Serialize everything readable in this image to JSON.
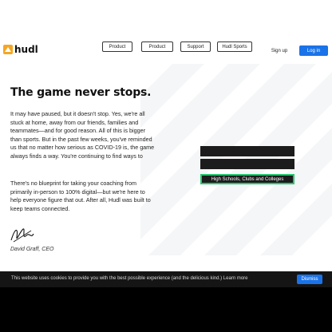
{
  "header": {
    "logo_text": "hudl",
    "nav": [
      "Product",
      "Product",
      "Support",
      "Hudl Sports"
    ],
    "signup_label": "Sign up",
    "login_label": "Log in"
  },
  "hero": {
    "heading": "The game never stops.",
    "paragraph1": "It may have paused, but it doesn't stop. Yes, we're all stuck at home, away from our friends, families and teammates—and for good reason. All of this is bigger than sports. But in the past few weeks, you've reminded us that no matter how serious as COVID-19 is, the game always finds a way. You're continuing to find ways to keep your athletes engaged, improving, and moving forward.",
    "paragraph2": "There's no blueprint for taking your coaching from primarily in-person to 100% digital—but we're here to help everyone figure that out. After all, Hudl was built to keep teams connected.",
    "signature_name": "David Graff, CEO"
  },
  "right": {
    "buttons": [
      "",
      "",
      "High Schools, Clubs and Colleges"
    ]
  },
  "cookie": {
    "text": "This website uses cookies to provide you with the best possible experience (and the delicious kind.) Learn more",
    "dismiss_label": "Dismiss"
  },
  "colors": {
    "brand_orange": "#f5a623",
    "accent_blue": "#1a73e8",
    "active_green": "#29c770"
  }
}
